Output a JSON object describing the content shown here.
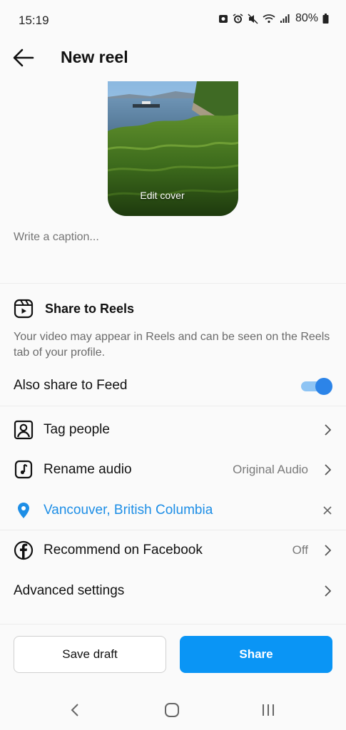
{
  "status_bar": {
    "time": "15:19",
    "battery": "80%"
  },
  "header": {
    "title": "New reel"
  },
  "cover": {
    "edit_label": "Edit cover"
  },
  "caption": {
    "placeholder": "Write a caption..."
  },
  "share_to_reels": {
    "title": "Share to Reels",
    "description": "Your video may appear in Reels and can be seen on the Reels tab of your profile."
  },
  "feed": {
    "label": "Also share to Feed",
    "enabled": true
  },
  "rows": {
    "tag_people": {
      "label": "Tag people"
    },
    "rename_audio": {
      "label": "Rename audio",
      "value": "Original Audio"
    },
    "location": {
      "label": "Vancouver, British Columbia"
    },
    "recommend": {
      "label": "Recommend on Facebook",
      "value": "Off"
    },
    "advanced": {
      "label": "Advanced settings"
    }
  },
  "buttons": {
    "save_draft": "Save draft",
    "share": "Share"
  },
  "colors": {
    "accent": "#0a95f5",
    "location": "#1d8ee6",
    "toggle_on": "#2c84e8"
  }
}
